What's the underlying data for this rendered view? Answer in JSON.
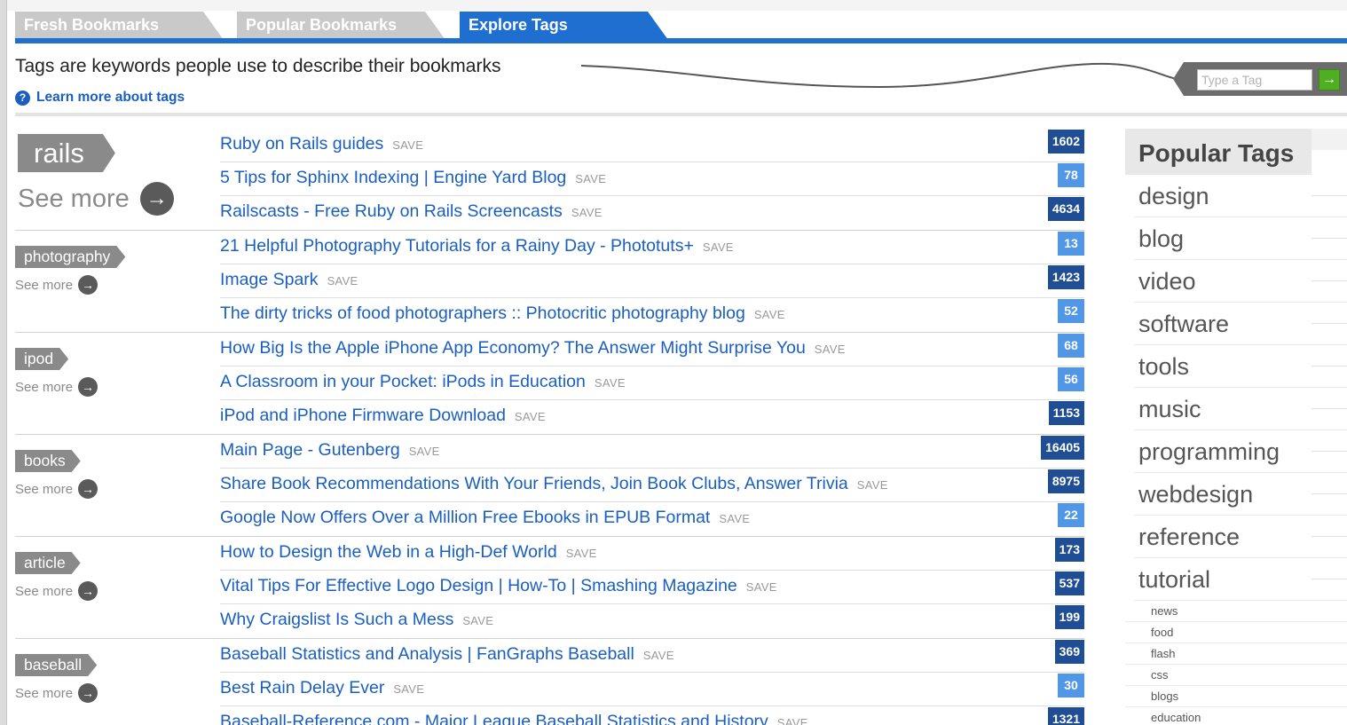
{
  "tabs": {
    "fresh": "Fresh Bookmarks",
    "popular": "Popular Bookmarks",
    "explore": "Explore Tags"
  },
  "intro": {
    "tagline": "Tags are keywords people use to describe their bookmarks",
    "learn_more": "Learn more about tags",
    "learn_icon": "?"
  },
  "tag_search": {
    "placeholder": "Type a Tag",
    "go_glyph": "→"
  },
  "see_more_label": "See more",
  "save_label": "SAVE",
  "colors": {
    "accent_blue": "#1f6fd1",
    "link_blue": "#1a5fbf",
    "count_dark": "#1f4e94",
    "count_light": "#5297e6",
    "go_green": "#4fae22",
    "tag_gray": "#8a8a8a"
  },
  "groups": [
    {
      "tag": "rails",
      "rows": [
        {
          "title": "Ruby on Rails guides",
          "count": "1602"
        },
        {
          "title": "5 Tips for Sphinx Indexing | Engine Yard Blog",
          "count": "78"
        },
        {
          "title": "Railscasts - Free Ruby on Rails Screencasts",
          "count": "4634"
        }
      ]
    },
    {
      "tag": "photography",
      "rows": [
        {
          "title": "21 Helpful Photography Tutorials for a Rainy Day - Phototuts+",
          "count": "13"
        },
        {
          "title": "Image Spark",
          "count": "1423"
        },
        {
          "title": "The dirty tricks of food photographers :: Photocritic photography blog",
          "count": "52"
        }
      ]
    },
    {
      "tag": "ipod",
      "rows": [
        {
          "title": "How Big Is the Apple iPhone App Economy? The Answer Might Surprise You",
          "count": "68"
        },
        {
          "title": "A Classroom in your Pocket: iPods in Education",
          "count": "56"
        },
        {
          "title": "iPod and iPhone Firmware Download",
          "count": "1153"
        }
      ]
    },
    {
      "tag": "books",
      "rows": [
        {
          "title": "Main Page - Gutenberg",
          "count": "16405"
        },
        {
          "title": "Share Book Recommendations With Your Friends, Join Book Clubs, Answer Trivia",
          "count": "8975"
        },
        {
          "title": "Google Now Offers Over a Million Free Ebooks in EPUB Format",
          "count": "22"
        }
      ]
    },
    {
      "tag": "article",
      "rows": [
        {
          "title": "How to Design the Web in a High-Def World",
          "count": "173"
        },
        {
          "title": "Vital Tips For Effective Logo Design | How-To | Smashing Magazine",
          "count": "537"
        },
        {
          "title": "Why Craigslist Is Such a Mess",
          "count": "199"
        }
      ]
    },
    {
      "tag": "baseball",
      "rows": [
        {
          "title": "Baseball Statistics and Analysis | FanGraphs Baseball",
          "count": "369"
        },
        {
          "title": "Best Rain Delay Ever",
          "count": "30"
        },
        {
          "title": "Baseball-Reference.com - Major League Baseball Statistics and History",
          "count": "1321"
        }
      ]
    }
  ],
  "popular_tags": {
    "title": "Popular Tags",
    "big": [
      "design",
      "blog",
      "video",
      "software",
      "tools",
      "music",
      "programming",
      "webdesign",
      "reference",
      "tutorial"
    ],
    "small": [
      "news",
      "food",
      "flash",
      "css",
      "blogs",
      "education"
    ]
  }
}
